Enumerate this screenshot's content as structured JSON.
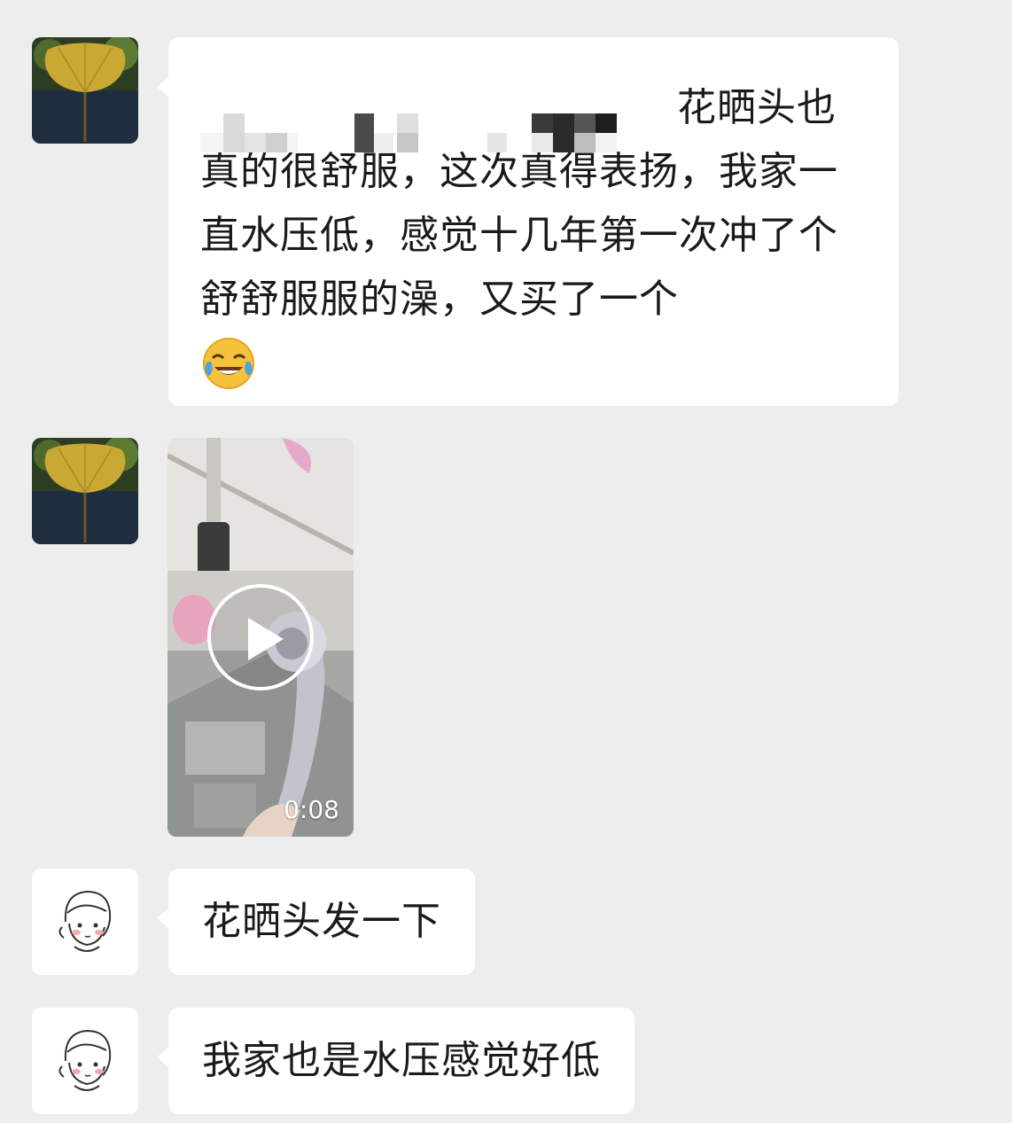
{
  "messages": [
    {
      "id": "m1",
      "sender": "ginkgo-user",
      "type": "text",
      "text": "花晒头也真的很舒服，这次真得表扬，我家一直水压低，感觉十几年第一次冲了个舒舒服服的澡，又买了一个",
      "emoji": "face-with-tears-of-joy-emoji"
    },
    {
      "id": "m2",
      "sender": "ginkgo-user",
      "type": "video",
      "duration": "0:08"
    },
    {
      "id": "m3",
      "sender": "sketch-girl-user",
      "type": "text",
      "text": "花晒头发一下"
    },
    {
      "id": "m4",
      "sender": "sketch-girl-user",
      "type": "text",
      "text": "我家也是水压感觉好低"
    }
  ],
  "colors": {
    "background": "#ededed",
    "bubble": "#ffffff",
    "text": "#1a1a1a"
  },
  "icons": [
    "play-icon",
    "ginkgo-leaf-avatar",
    "sketch-girl-avatar"
  ]
}
